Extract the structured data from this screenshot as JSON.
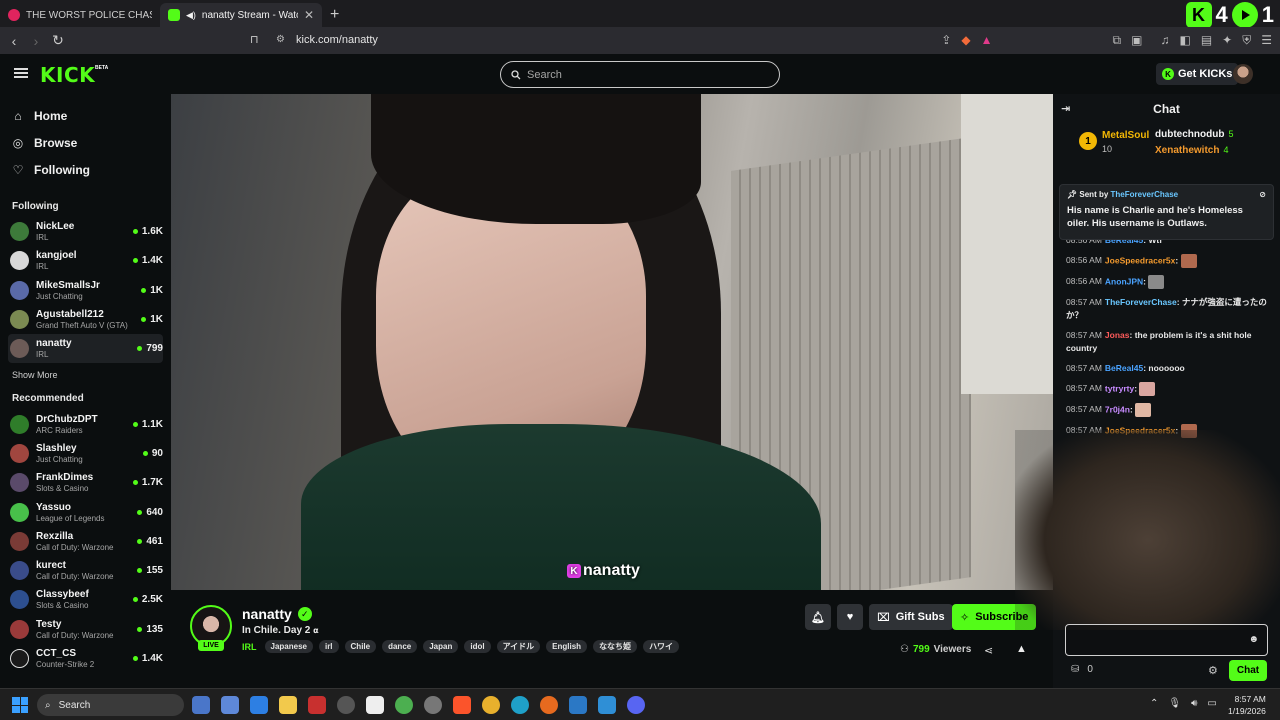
{
  "browser": {
    "tabs": [
      {
        "title": "THE WORST POLICE CHASE I'VE EVER",
        "active": false
      },
      {
        "title": "nanatty Stream - Watch Live o",
        "active": true
      }
    ],
    "url": "kick.com/nanatty",
    "overlay_number_1": "4",
    "overlay_number_2": "1"
  },
  "header": {
    "logo": "KICK",
    "beta": "BETA",
    "search_placeholder": "Search",
    "get_kicks": "Get KICKs",
    "accent": "#53fc18"
  },
  "sidebar": {
    "nav": [
      {
        "label": "Home",
        "icon": "home-icon"
      },
      {
        "label": "Browse",
        "icon": "compass-icon"
      },
      {
        "label": "Following",
        "icon": "heart-icon"
      }
    ],
    "following_title": "Following",
    "following": [
      {
        "name": "NickLee",
        "category": "IRL",
        "viewers": "1.6K"
      },
      {
        "name": "kangjoel",
        "category": "IRL",
        "viewers": "1.4K"
      },
      {
        "name": "MikeSmallsJr",
        "category": "Just Chatting",
        "viewers": "1K"
      },
      {
        "name": "Agustabell212",
        "category": "Grand Theft Auto V (GTA)",
        "viewers": "1K"
      },
      {
        "name": "nanatty",
        "category": "IRL",
        "viewers": "799"
      }
    ],
    "show_more": "Show More",
    "recommended_title": "Recommended",
    "recommended": [
      {
        "name": "DrChubzDPT",
        "category": "ARC Raiders",
        "viewers": "1.1K"
      },
      {
        "name": "Slashley",
        "category": "Just Chatting",
        "viewers": "90"
      },
      {
        "name": "FrankDimes",
        "category": "Slots & Casino",
        "viewers": "1.7K"
      },
      {
        "name": "Yassuo",
        "category": "League of Legends",
        "viewers": "640"
      },
      {
        "name": "Rexzilla",
        "category": "Call of Duty: Warzone",
        "viewers": "461"
      },
      {
        "name": "kurect",
        "category": "Call of Duty: Warzone",
        "viewers": "155"
      },
      {
        "name": "Classybeef",
        "category": "Slots & Casino",
        "viewers": "2.5K"
      },
      {
        "name": "Testy",
        "category": "Call of Duty: Warzone",
        "viewers": "135"
      },
      {
        "name": "CCT_CS",
        "category": "Counter-Strike 2",
        "viewers": "1.4K"
      }
    ]
  },
  "video": {
    "watermark": "nanatty"
  },
  "stream": {
    "channel": "nanatty",
    "live": "LIVE",
    "title": "In Chile. Day 2",
    "category": "IRL",
    "tags": [
      "Japanese",
      "irl",
      "Chile",
      "dance",
      "Japan",
      "idol",
      "アイドル",
      "English",
      "ななち姫",
      "ハワイ"
    ],
    "gift_subs": "Gift Subs",
    "subscribe": "Subscribe",
    "viewers": "799",
    "viewers_label": "Viewers"
  },
  "chat": {
    "title": "Chat",
    "leaders": {
      "first_name": "MetalSoul",
      "first_count": "10",
      "second_name": "dubtechnodub",
      "second_count": "5",
      "third_name": "Xenathewitch",
      "third_count": "4"
    },
    "pinned": {
      "sent_by": "Sent by",
      "user": "TheForeverChase",
      "message": "His name is Charlie and he's Homeless oiler. His username is Outlaws."
    },
    "messages": [
      {
        "time": "08:56 AM",
        "user": "BeReal45",
        "color": "#4aa3ff",
        "text": ": Wtf"
      },
      {
        "time": "08:56 AM",
        "user": "JoeSpeedracer5x",
        "color": "#f39a2e",
        "text": ":"
      },
      {
        "time": "08:56 AM",
        "user": "AnonJPN",
        "color": "#4aa3ff",
        "text": ":"
      },
      {
        "time": "08:57 AM",
        "user": "TheForeverChase",
        "color": "#6ac7ff",
        "text": ": ナナが強盗に遭ったのか？"
      },
      {
        "time": "08:57 AM",
        "user": "Jonas",
        "color": "#ff5b5b",
        "text": ": the problem is it's a shit hole country"
      },
      {
        "time": "08:57 AM",
        "user": "BeReal45",
        "color": "#4aa3ff",
        "text": ": noooooo"
      },
      {
        "time": "08:57 AM",
        "user": "tytryrty",
        "color": "#c78bff",
        "text": ":"
      },
      {
        "time": "08:57 AM",
        "user": "7r0j4n",
        "color": "#c78bff",
        "text": ":"
      },
      {
        "time": "08:57 AM",
        "user": "JoeSpeedracer5x",
        "color": "#f39a2e",
        "text": ":"
      }
    ],
    "kicks_count": "0",
    "chat_button": "Chat"
  },
  "taskbar": {
    "search": "Search",
    "time": "8:57 AM",
    "date": "1/19/2026"
  }
}
